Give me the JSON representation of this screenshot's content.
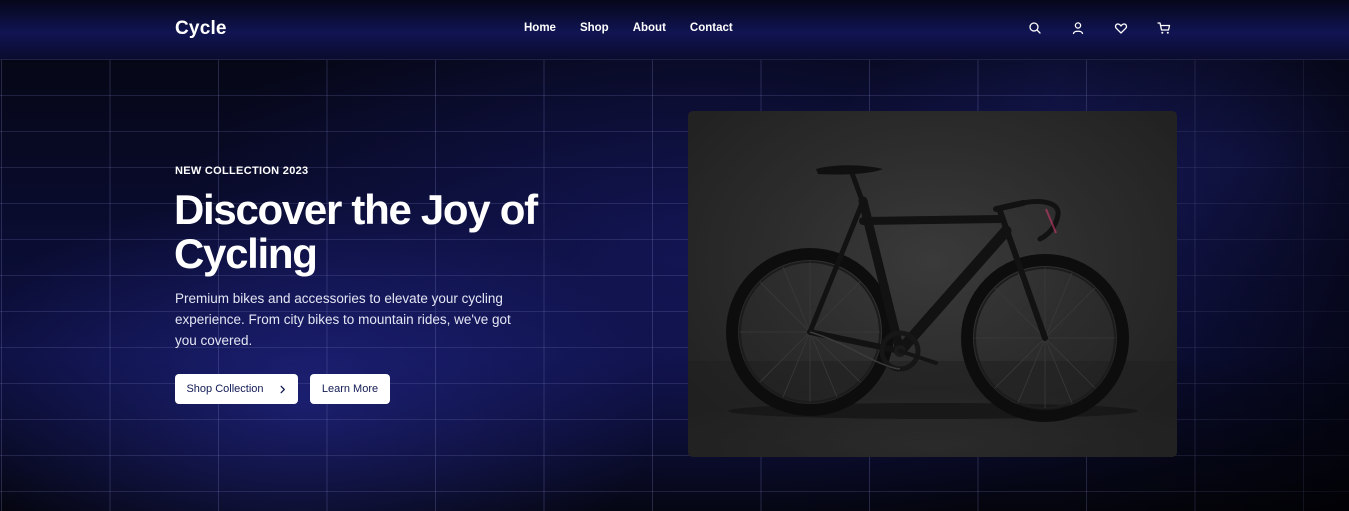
{
  "header": {
    "logo": "Cycle",
    "nav": [
      "Home",
      "Shop",
      "About",
      "Contact"
    ],
    "icons": [
      "search-icon",
      "user-icon",
      "heart-icon",
      "cart-icon"
    ]
  },
  "hero": {
    "eyebrow": "NEW COLLECTION 2023",
    "title": "Discover the Joy of Cycling",
    "subtitle": "Premium bikes and accessories to elevate your cycling experience. From city bikes to mountain rides, we've got you covered.",
    "primary_button": "Shop Collection",
    "secondary_button": "Learn More"
  },
  "colors": {
    "background": "#05060f",
    "accent_blue": "#101452",
    "button_text": "#111a55",
    "button_bg": "#ffffff"
  }
}
